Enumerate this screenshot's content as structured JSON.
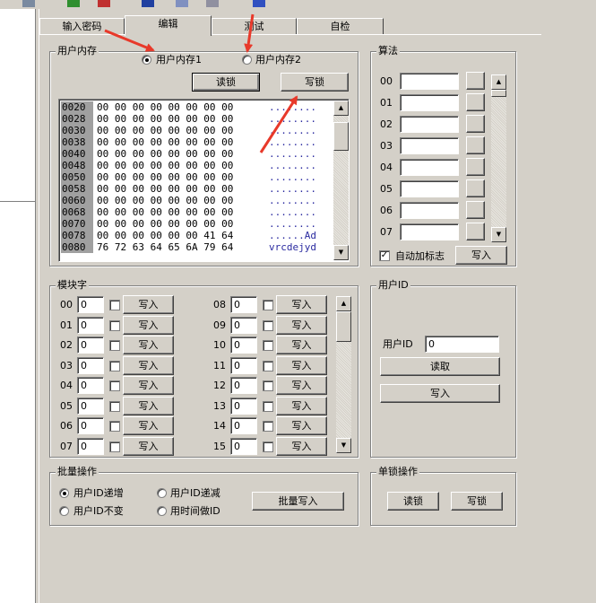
{
  "tabs": [
    {
      "label": "输入密码",
      "active": false
    },
    {
      "label": "编辑",
      "active": true
    },
    {
      "label": "测试",
      "active": false
    },
    {
      "label": "自检",
      "active": false
    }
  ],
  "memory": {
    "title": "用户内存",
    "radio1": "用户内存1",
    "radio2": "用户内存2",
    "read_lock": "读锁",
    "write_lock": "写锁",
    "rows": [
      {
        "addr": "0020",
        "bytes": "00 00 00 00 00 00 00 00",
        "ascii": "........"
      },
      {
        "addr": "0028",
        "bytes": "00 00 00 00 00 00 00 00",
        "ascii": "........"
      },
      {
        "addr": "0030",
        "bytes": "00 00 00 00 00 00 00 00",
        "ascii": "........"
      },
      {
        "addr": "0038",
        "bytes": "00 00 00 00 00 00 00 00",
        "ascii": "........"
      },
      {
        "addr": "0040",
        "bytes": "00 00 00 00 00 00 00 00",
        "ascii": "........"
      },
      {
        "addr": "0048",
        "bytes": "00 00 00 00 00 00 00 00",
        "ascii": "........"
      },
      {
        "addr": "0050",
        "bytes": "00 00 00 00 00 00 00 00",
        "ascii": "........"
      },
      {
        "addr": "0058",
        "bytes": "00 00 00 00 00 00 00 00",
        "ascii": "........"
      },
      {
        "addr": "0060",
        "bytes": "00 00 00 00 00 00 00 00",
        "ascii": "........"
      },
      {
        "addr": "0068",
        "bytes": "00 00 00 00 00 00 00 00",
        "ascii": "........"
      },
      {
        "addr": "0070",
        "bytes": "00 00 00 00 00 00 00 00",
        "ascii": "........"
      },
      {
        "addr": "0078",
        "bytes": "00 00 00 00 00 00 41 64",
        "ascii": "......Ad"
      },
      {
        "addr": "0080",
        "bytes": "76 72 63 64 65 6A 79 64",
        "ascii": "vrcdejyd"
      }
    ]
  },
  "algorithm": {
    "title": "算法",
    "rows": [
      "00",
      "01",
      "02",
      "03",
      "04",
      "05",
      "06",
      "07"
    ],
    "auto_flag": "自动加标志",
    "write": "写入"
  },
  "module": {
    "title": "模块字",
    "left": [
      "00",
      "01",
      "02",
      "03",
      "04",
      "05",
      "06",
      "07"
    ],
    "right": [
      "08",
      "09",
      "10",
      "11",
      "12",
      "13",
      "14",
      "15"
    ],
    "value": "0",
    "write": "写入"
  },
  "userid": {
    "title": "用户ID",
    "label": "用户ID",
    "value": "0",
    "read": "读取",
    "write": "写入"
  },
  "batch": {
    "title": "批量操作",
    "opt1": "用户ID递增",
    "opt2": "用户ID递减",
    "opt3": "用户ID不变",
    "opt4": "用时间做ID",
    "button": "批量写入"
  },
  "single": {
    "title": "单锁操作",
    "read_lock": "读锁",
    "write_lock": "写锁"
  }
}
